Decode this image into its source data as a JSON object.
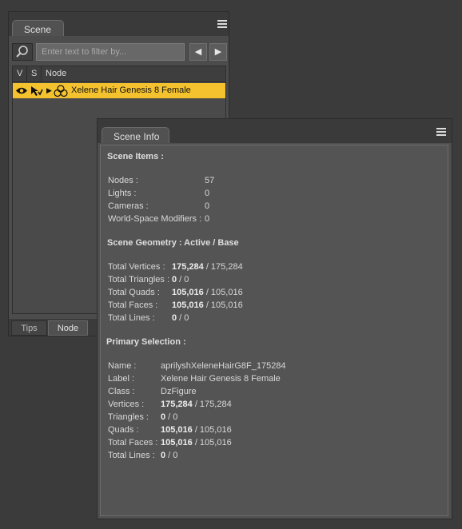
{
  "scene_panel": {
    "tab_label": "Scene",
    "filter_placeholder": "Enter text to filter by...",
    "columns": [
      "V",
      "S",
      "Node"
    ],
    "selected_node": "Xelene Hair Genesis 8 Female",
    "bottom_tabs": [
      "Tips",
      "Node"
    ],
    "active_bottom_tab": "Node",
    "selection_color": "#f4c22f"
  },
  "info_panel": {
    "tab_label": "Scene Info",
    "scene_items": {
      "title": "Scene Items :",
      "rows": [
        {
          "label": "Nodes :",
          "value": "57"
        },
        {
          "label": "Lights :",
          "value": "0"
        },
        {
          "label": "Cameras :",
          "value": "0"
        },
        {
          "label": "World-Space Modifiers :",
          "value": "0"
        }
      ]
    },
    "geometry": {
      "title": "Scene Geometry : Active / Base",
      "rows": [
        {
          "label": "Total Vertices :",
          "active": "175,284",
          "base": " / 175,284"
        },
        {
          "label": "Total Triangles :",
          "active": "0",
          "base": " / 0"
        },
        {
          "label": "Total Quads :",
          "active": "105,016",
          "base": " / 105,016"
        },
        {
          "label": "Total Faces :",
          "active": "105,016",
          "base": " / 105,016"
        },
        {
          "label": "Total Lines :",
          "active": "0",
          "base": " / 0"
        }
      ]
    },
    "primary": {
      "title": "Primary Selection :",
      "name_label": "Name :",
      "name_value": "aprilyshXeleneHairG8F_175284",
      "label_label": "Label :",
      "label_value": "Xelene Hair Genesis 8 Female",
      "class_label": "Class :",
      "class_value": "DzFigure",
      "rows": [
        {
          "label": "Vertices :",
          "active": "175,284",
          "base": " / 175,284"
        },
        {
          "label": "Triangles :",
          "active": "0",
          "base": " / 0"
        },
        {
          "label": "Quads :",
          "active": "105,016",
          "base": " / 105,016"
        },
        {
          "label": "Total Faces :",
          "active": "105,016",
          "base": " / 105,016"
        },
        {
          "label": "Total Lines :",
          "active": "0",
          "base": " / 0"
        }
      ]
    }
  },
  "icons": [
    "close-icon",
    "panel-menu-icon",
    "search-icon",
    "arrow-left-icon",
    "arrow-right-icon",
    "eye-icon",
    "select-cursor-icon",
    "expand-triangle-icon",
    "figure-node-icon"
  ]
}
